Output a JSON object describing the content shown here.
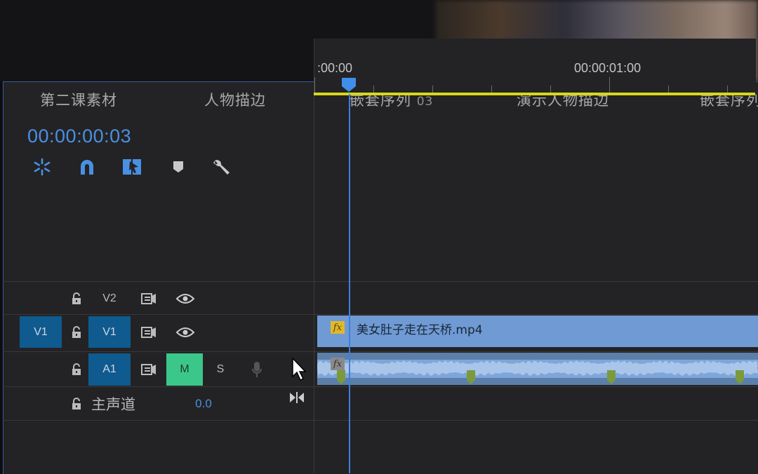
{
  "tabs": [
    {
      "label": "第二课素材",
      "num": ""
    },
    {
      "label": "人物描边",
      "num": ""
    },
    {
      "label": "嵌套序列 ",
      "num": "03"
    },
    {
      "label": "演示人物描边",
      "num": ""
    },
    {
      "label": "嵌套序列",
      "num": ""
    }
  ],
  "timecode": "00:00:00:03",
  "toolbar": {
    "icons": [
      "snap-icon",
      "magnet-link-icon",
      "linked-selection-icon",
      "marker-icon",
      "wrench-icon"
    ]
  },
  "ruler": {
    "labels": [
      ":00:00",
      "00:00:01:00"
    ]
  },
  "tracks": {
    "v2": {
      "label": "V2"
    },
    "v1": {
      "source": "V1",
      "label": "V1"
    },
    "a1": {
      "label": "A1",
      "mute": "M",
      "solo": "S"
    },
    "master": {
      "label": "主声道",
      "value": "0.0"
    }
  },
  "clips": {
    "video": {
      "name": "美女肚子走在天桥.mp4",
      "fx": "fx"
    },
    "audio": {
      "fx": "fx"
    }
  },
  "colors": {
    "accent": "#4a90e2",
    "work_area": "#d6d81e",
    "video_clip": "#6f9ad4",
    "audio_clip": "#5b7fa8",
    "mute_active": "#3cc78a",
    "track_target": "#0f5a8e"
  }
}
